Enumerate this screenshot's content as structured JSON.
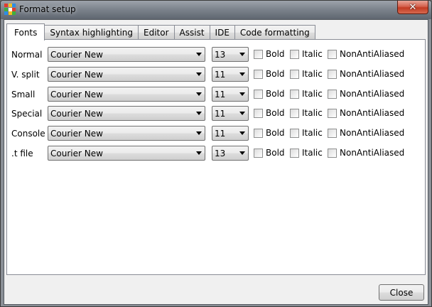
{
  "window": {
    "title": "Format setup",
    "close_glyph": "✕",
    "icon": "app-grid-icon",
    "icon_colors": [
      "#e23b2e",
      "#f3c020",
      "#2f8de4",
      "#3fae3f",
      "#ffffff",
      "#e23b2e",
      "#2f8de4",
      "#f3c020",
      "#3fae3f"
    ]
  },
  "tabs": [
    {
      "label": "Fonts",
      "active": true
    },
    {
      "label": "Syntax highlighting"
    },
    {
      "label": "Editor"
    },
    {
      "label": "Assist"
    },
    {
      "label": "IDE"
    },
    {
      "label": "Code formatting"
    }
  ],
  "rows": [
    {
      "label": "Normal",
      "font": "Courier New",
      "size": "13",
      "bold": "Bold",
      "italic": "Italic",
      "nonaa": "NonAntiAliased"
    },
    {
      "label": "V. split",
      "font": "Courier New",
      "size": "11",
      "bold": "Bold",
      "italic": "Italic",
      "nonaa": "NonAntiAliased"
    },
    {
      "label": "Small",
      "font": "Courier New",
      "size": "11",
      "bold": "Bold",
      "italic": "Italic",
      "nonaa": "NonAntiAliased"
    },
    {
      "label": "Special",
      "font": "Courier New",
      "size": "11",
      "bold": "Bold",
      "italic": "Italic",
      "nonaa": "NonAntiAliased"
    },
    {
      "label": "Console",
      "font": "Courier New",
      "size": "11",
      "bold": "Bold",
      "italic": "Italic",
      "nonaa": "NonAntiAliased"
    },
    {
      "label": ".t file",
      "font": "Courier New",
      "size": "13",
      "bold": "Bold",
      "italic": "Italic",
      "nonaa": "NonAntiAliased"
    }
  ],
  "footer": {
    "close_label": "Close"
  }
}
